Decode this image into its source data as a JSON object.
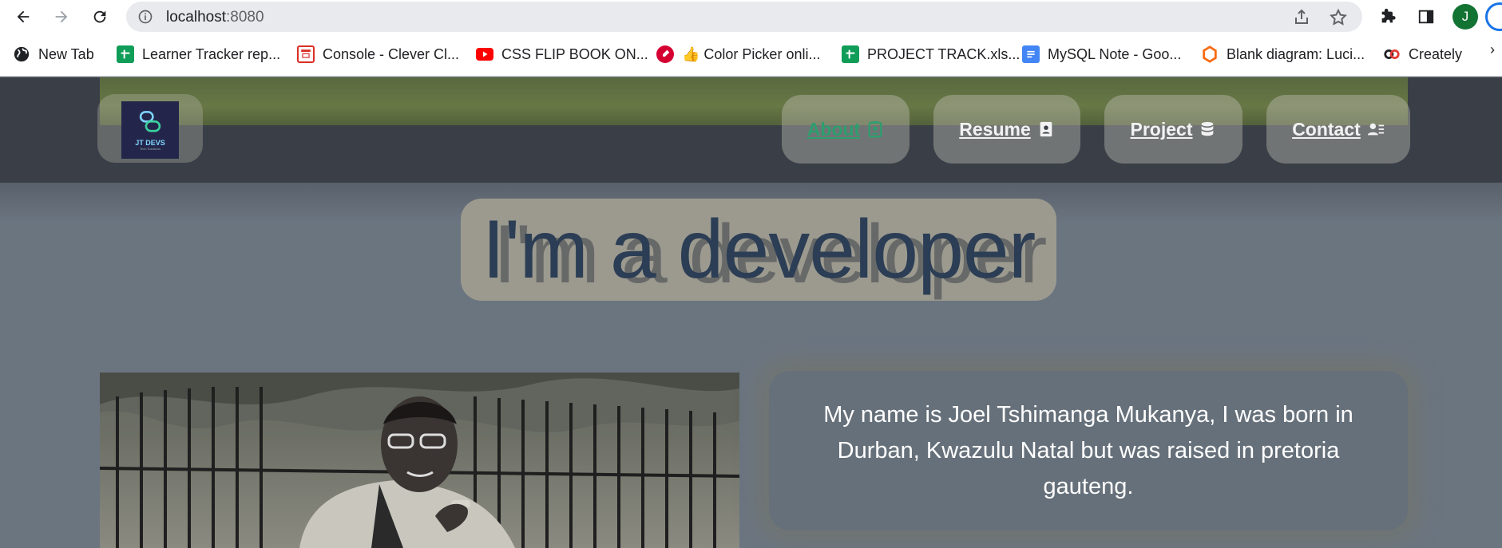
{
  "browser": {
    "url_host": "localhost",
    "url_port": ":8080",
    "avatar_initial": "J",
    "bookmarks": [
      {
        "label": "New Tab",
        "icon": "globe-icon"
      },
      {
        "label": "Learner Tracker rep...",
        "icon": "sheets-icon"
      },
      {
        "label": "Console - Clever Cl...",
        "icon": "console-icon"
      },
      {
        "label": "CSS FLIP BOOK ON...",
        "icon": "youtube-icon"
      },
      {
        "label": "👍 Color Picker onli...",
        "icon": "color-picker-icon"
      },
      {
        "label": "PROJECT TRACK.xls...",
        "icon": "sheets-icon"
      },
      {
        "label": "MySQL Note - Goo...",
        "icon": "docs-icon"
      },
      {
        "label": "Blank diagram: Luci...",
        "icon": "lucid-icon"
      },
      {
        "label": "Creately",
        "icon": "creately-icon"
      }
    ],
    "more": "›"
  },
  "site": {
    "logo_text": "JT DEVS",
    "logo_sub": "Tech Solutions",
    "nav": [
      {
        "label": "About",
        "active": true,
        "icon": "person-badge-icon"
      },
      {
        "label": "Resume",
        "active": false,
        "icon": "id-card-icon"
      },
      {
        "label": "Project",
        "active": false,
        "icon": "database-icon"
      },
      {
        "label": "Contact",
        "active": false,
        "icon": "contact-list-icon"
      }
    ],
    "hero_title": "I'm a developer",
    "intro": "My name is Joel Tshimanga Mukanya, I was born in Durban, Kwazulu Natal but was raised in pretoria gauteng."
  },
  "colors": {
    "header_bg": "#3a3f47",
    "page_bg": "#6b7580",
    "active_nav": "#2e9e6f",
    "hero_text": "#2c3e55"
  }
}
